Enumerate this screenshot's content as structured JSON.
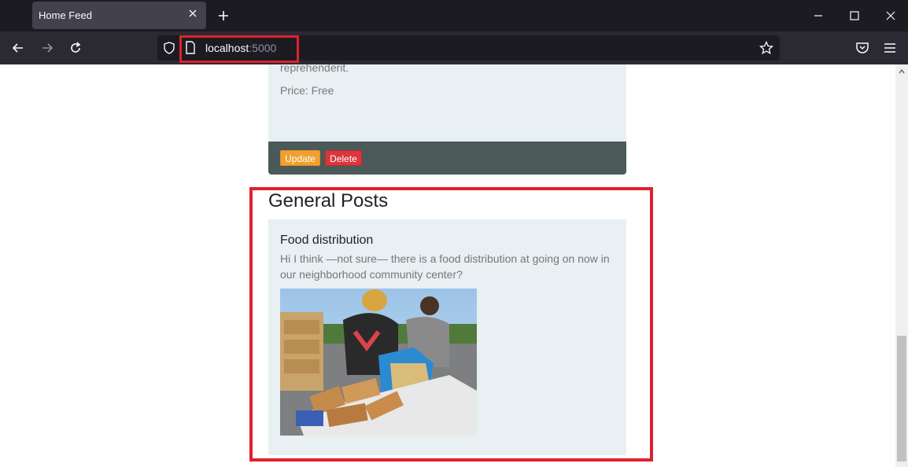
{
  "browser": {
    "tab_title": "Home Feed",
    "url_host": "localhost",
    "url_port": ":5000"
  },
  "top_card": {
    "description_tail": "reprehenderit.",
    "price": "Price: Free",
    "update_label": "Update",
    "delete_label": "Delete"
  },
  "general_posts": {
    "section_title": "General Posts",
    "posts": [
      {
        "title": "Food distribution",
        "body": "Hi I think —not sure— there is a food distribution at going on now in our neighborhood community center?"
      }
    ]
  },
  "colors": {
    "highlight": "#e0202e",
    "card_bg": "#e8f0f3",
    "footer_bg": "#4b5a59",
    "update_btn": "#f0a030",
    "delete_btn": "#d9363e"
  }
}
